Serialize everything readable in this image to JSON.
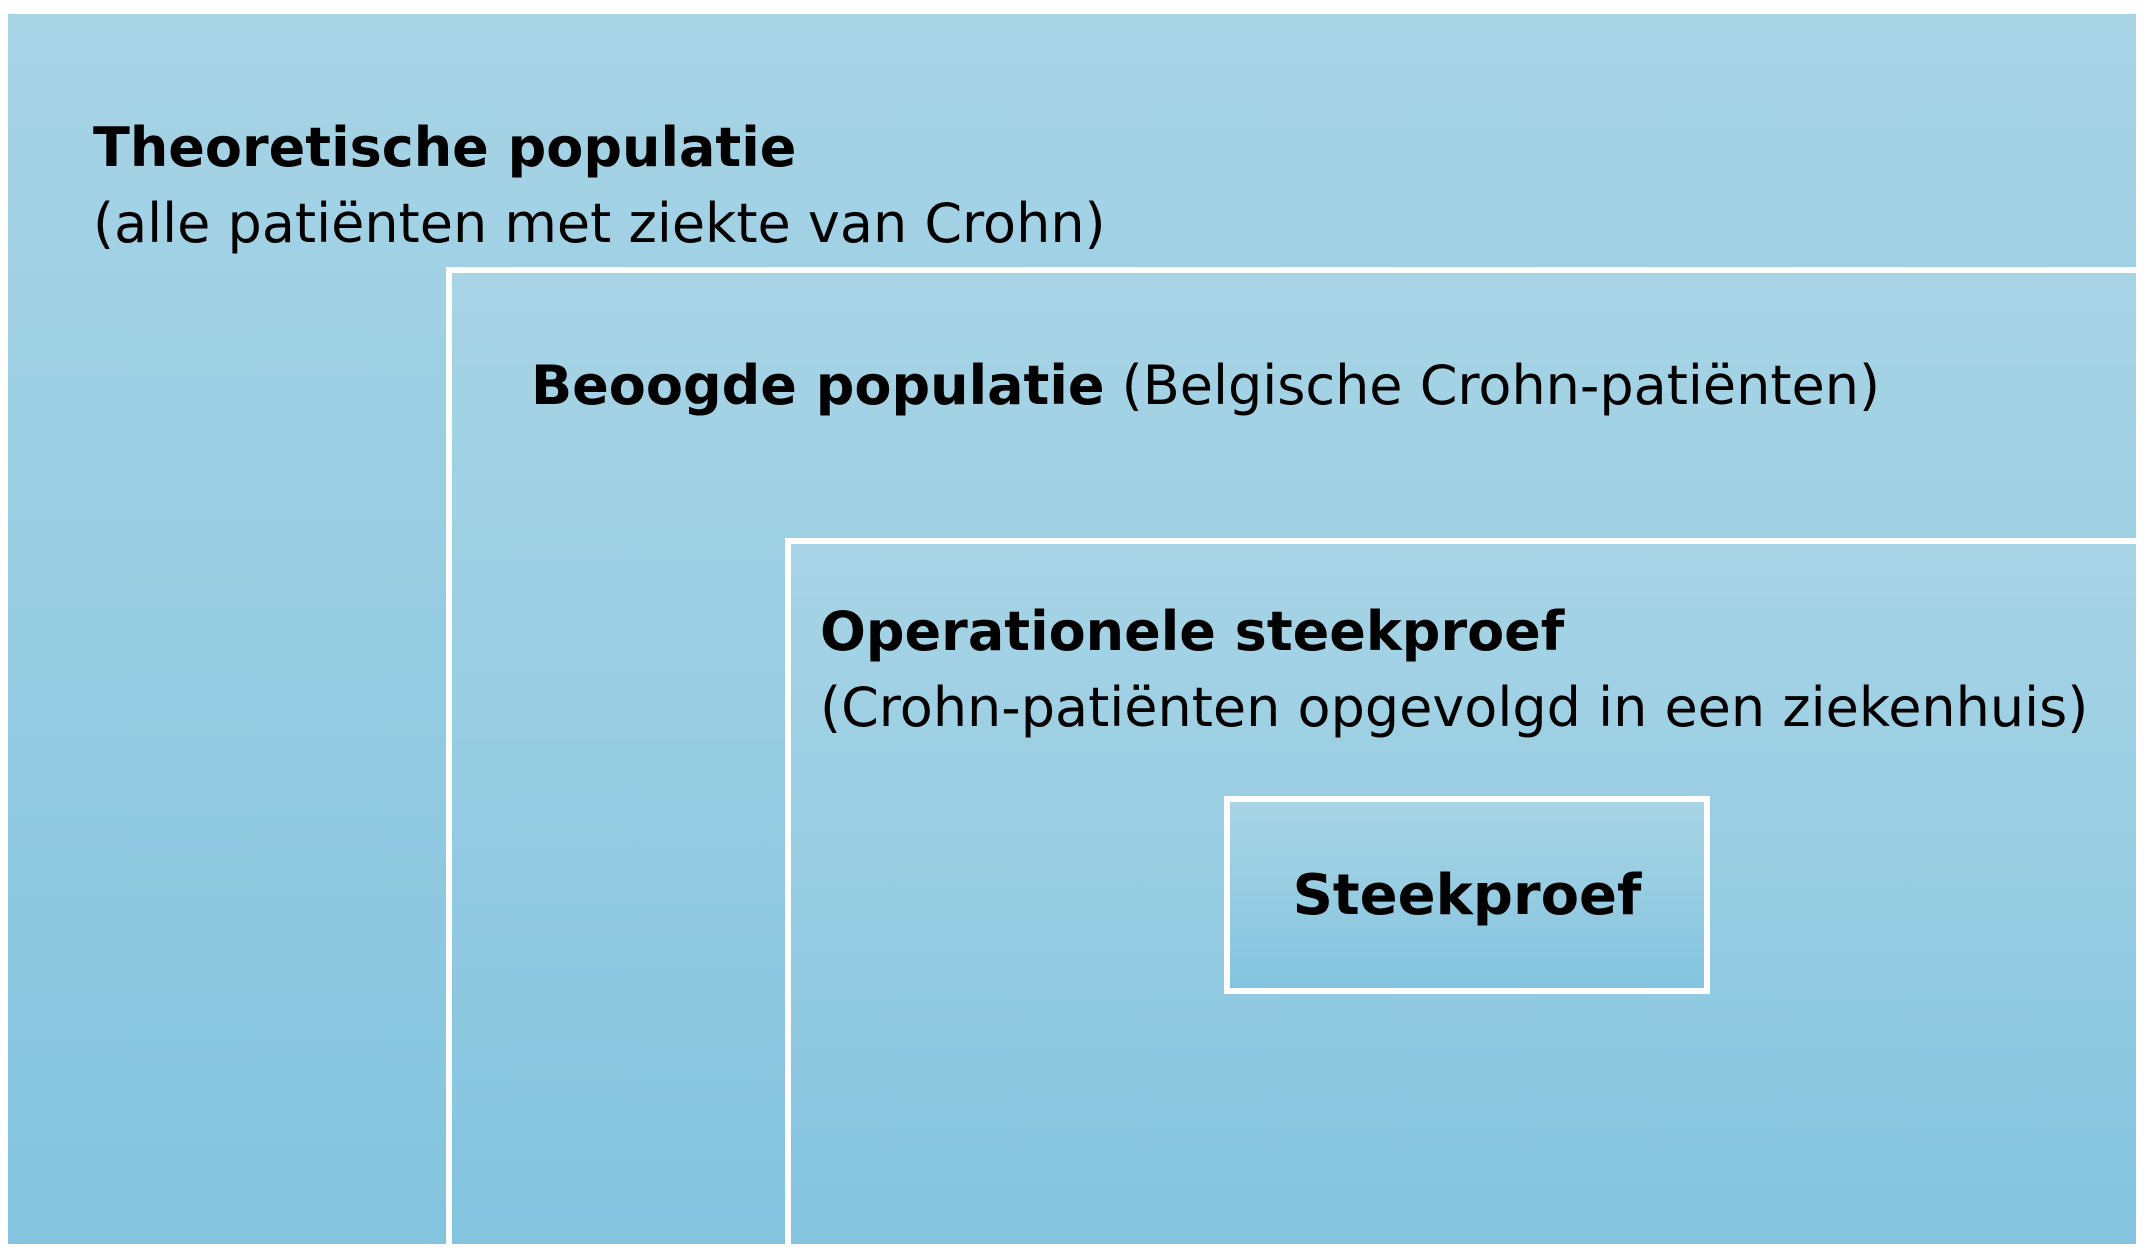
{
  "diagram": {
    "outer": {
      "title": "Theoretische populatie",
      "description": "(alle patiënten met ziekte van Crohn)"
    },
    "level2": {
      "title": "Beoogde populatie",
      "description": "(Belgische Crohn-patiënten)"
    },
    "level3": {
      "title": "Operationele steekproef",
      "description": "(Crohn-patiënten opgevolgd in een ziekenhuis)"
    },
    "sample": {
      "title": "Steekproef"
    },
    "colors": {
      "box_top": "#a8d4e6",
      "box_bottom": "#84c4de",
      "border": "#ffffff",
      "text": "#000000"
    }
  }
}
